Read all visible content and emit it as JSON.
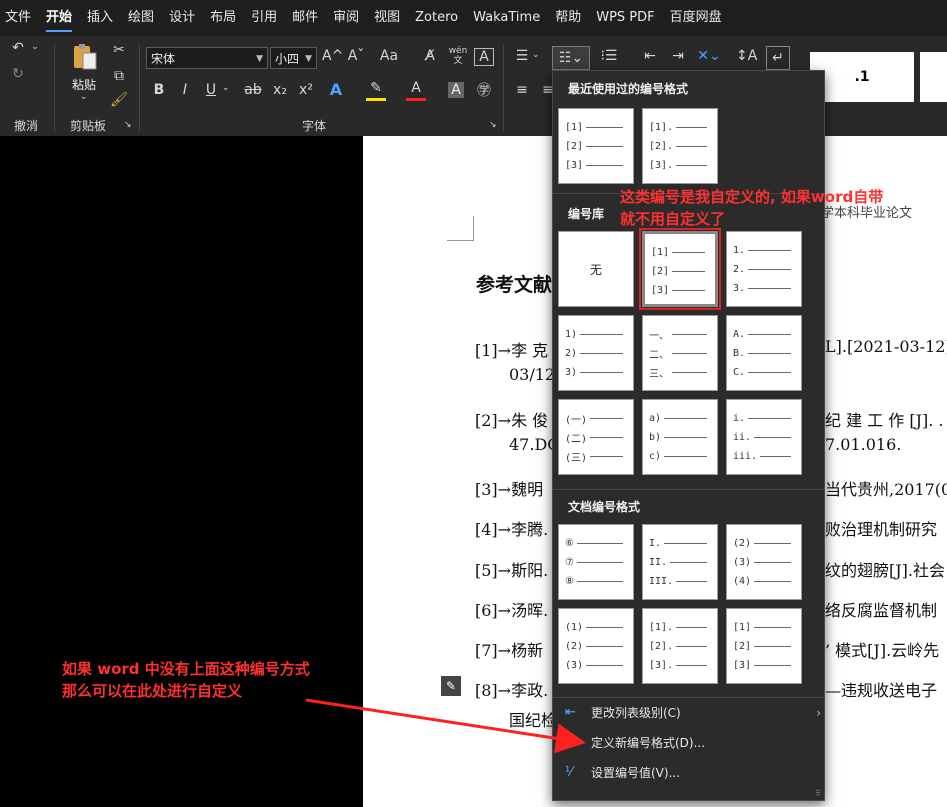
{
  "menubar": {
    "items": [
      "文件",
      "开始",
      "插入",
      "绘图",
      "设计",
      "布局",
      "引用",
      "邮件",
      "审阅",
      "视图",
      "Zotero",
      "WakaTime",
      "帮助",
      "WPS PDF",
      "百度网盘"
    ]
  },
  "ribbon": {
    "undo_label": "撤消",
    "clipboard_label": "剪贴板",
    "paste_label": "粘贴",
    "font_label": "字体",
    "font_name": "宋体",
    "font_size": "小四",
    "bold": "B",
    "italic": "I",
    "underline": "U",
    "strike": "ab",
    "subscript": "x₂",
    "superscript": "x²",
    "grow_font": "A^",
    "shrink_font": "Aˇ",
    "change_case": "Aa",
    "pinyin_top": "wén",
    "pinyin_bottom": "文",
    "style_box": ".1"
  },
  "document": {
    "header_fragment": "学本科毕业论文",
    "section_title": "参考文献",
    "refs": [
      {
        "text": "[1]→李 克",
        "tail": "L].[2021-03-12]."
      },
      {
        "text": "03/12",
        "tail": ""
      },
      {
        "text": "[2]→朱 俊",
        "tail": "纪 建 工 作 [J]. ."
      },
      {
        "text": "47.DO",
        "tail": "7.01.016."
      },
      {
        "text": "[3]→魏明",
        "tail": "当代贵州,2017(0"
      },
      {
        "text": "[4]→李腾.",
        "tail": "败治理机制研究"
      },
      {
        "text": "[5]→斯阳.",
        "tail": "纹的翅膀[J].社会"
      },
      {
        "text": "[6]→汤晖.",
        "tail": "络反腐监督机制"
      },
      {
        "text": "[7]→杨新",
        "tail": "’ 模式[J].云岭先"
      },
      {
        "text": "[8]→李政.",
        "tail": "—违规收送电子"
      },
      {
        "text": "国纪检",
        "tail": ""
      }
    ]
  },
  "dropdown": {
    "recent_heading": "最近使用过的编号格式",
    "library_heading": "编号库",
    "document_heading": "文档编号格式",
    "none_label": "无",
    "recent_tiles": [
      [
        "[1]",
        "[2]",
        "[3]"
      ],
      [
        "[1].",
        "[2].",
        "[3]."
      ]
    ],
    "library_tiles": [
      [
        "[1]",
        "[2]",
        "[3]"
      ],
      [
        "1.",
        "2.",
        "3."
      ],
      [
        "1)",
        "2)",
        "3)"
      ],
      [
        "一、",
        "二、",
        "三、"
      ],
      [
        "A.",
        "B.",
        "C."
      ],
      [
        "(一)",
        "(二)",
        "(三)"
      ],
      [
        "a)",
        "b)",
        "c)"
      ],
      [
        "i.",
        "ii.",
        "iii."
      ]
    ],
    "document_tiles": [
      [
        "⑥",
        "⑦",
        "⑧"
      ],
      [
        "I.",
        "II.",
        "III."
      ],
      [
        "(2)",
        "(3)",
        "(4)"
      ],
      [
        "(1)",
        "(2)",
        "(3)"
      ],
      [
        "[1].",
        "[2].",
        "[3]."
      ],
      [
        "[1]",
        "[2]",
        "[3]"
      ]
    ],
    "cmd_change_level": "更改列表级别(C)",
    "cmd_define_new": "定义新编号格式(D)...",
    "cmd_set_value": "设置编号值(V)..."
  },
  "annotations": {
    "top_line1": "这类编号是我自定义的, 如果word自带",
    "top_line2": "就不用自定义了",
    "bottom_line1": "如果 word 中没有上面这种编号方式",
    "bottom_line2": "那么可以在此处进行自定义"
  },
  "colors": {
    "accent": "#4aa3ff",
    "annotation": "#ff3030"
  }
}
